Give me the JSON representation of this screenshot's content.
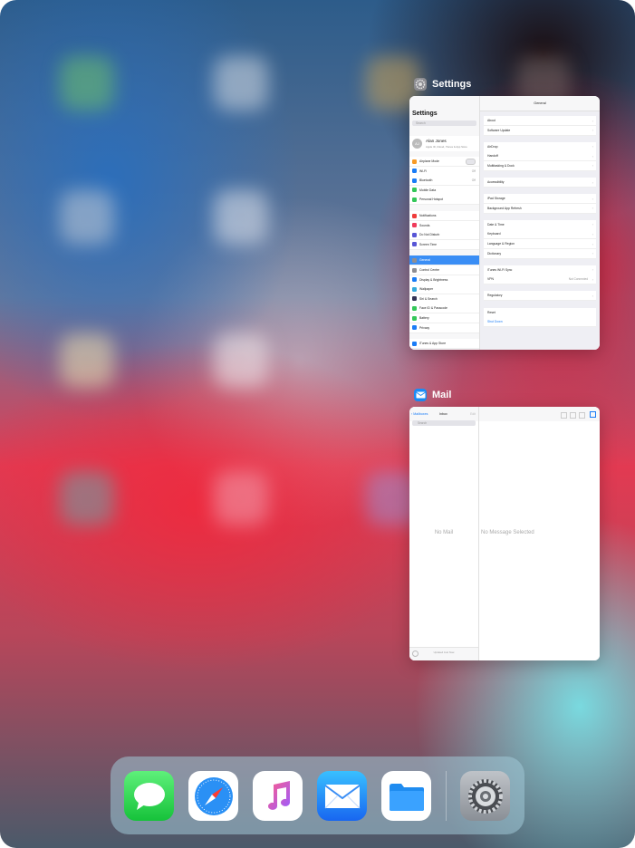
{
  "switcher": {
    "settings_card": {
      "app_name": "Settings",
      "sidebar": {
        "title": "Settings",
        "search_placeholder": "Search",
        "profile": {
          "name": "Alan Jones",
          "subtitle": "Apple ID, iCloud, iTunes & App Store",
          "initials": "AJ"
        },
        "groups": [
          [
            {
              "label": "Airplane Mode",
              "color": "#f79a26",
              "value": ""
            },
            {
              "label": "Wi-Fi",
              "color": "#1a7cf6",
              "value": "Off"
            },
            {
              "label": "Bluetooth",
              "color": "#1a7cf6",
              "value": "Off"
            },
            {
              "label": "Mobile Data",
              "color": "#34c759",
              "value": ""
            },
            {
              "label": "Personal Hotspot",
              "color": "#34c759",
              "value": ""
            }
          ],
          [
            {
              "label": "Notifications",
              "color": "#ef3b3b",
              "value": ""
            },
            {
              "label": "Sounds",
              "color": "#ef3b5b",
              "value": ""
            },
            {
              "label": "Do Not Disturb",
              "color": "#5856d6",
              "value": ""
            },
            {
              "label": "Screen Time",
              "color": "#5856d6",
              "value": ""
            }
          ],
          [
            {
              "label": "General",
              "color": "#8e8e93",
              "value": ""
            },
            {
              "label": "Control Centre",
              "color": "#8e8e93",
              "value": ""
            },
            {
              "label": "Display & Brightness",
              "color": "#1a7cf6",
              "value": ""
            },
            {
              "label": "Wallpaper",
              "color": "#35aadc",
              "value": ""
            },
            {
              "label": "Siri & Search",
              "color": "#333355",
              "value": ""
            },
            {
              "label": "Face ID & Passcode",
              "color": "#34c759",
              "value": ""
            },
            {
              "label": "Battery",
              "color": "#34c759",
              "value": ""
            },
            {
              "label": "Privacy",
              "color": "#1a7cf6",
              "value": ""
            }
          ],
          [
            {
              "label": "iTunes & App Store",
              "color": "#1a7cf6",
              "value": ""
            }
          ]
        ]
      },
      "main": {
        "nav_title": "General",
        "groups": [
          [
            {
              "label": "About",
              "value": ""
            },
            {
              "label": "Software Update",
              "value": ""
            }
          ],
          [
            {
              "label": "AirDrop",
              "value": ""
            },
            {
              "label": "Handoff",
              "value": ""
            },
            {
              "label": "Multitasking & Dock",
              "value": ""
            }
          ],
          [
            {
              "label": "Accessibility",
              "value": ""
            }
          ],
          [
            {
              "label": "iPad Storage",
              "value": ""
            },
            {
              "label": "Background App Refresh",
              "value": ""
            }
          ],
          [
            {
              "label": "Date & Time",
              "value": ""
            },
            {
              "label": "Keyboard",
              "value": ""
            },
            {
              "label": "Language & Region",
              "value": ""
            },
            {
              "label": "Dictionary",
              "value": ""
            }
          ],
          [
            {
              "label": "iTunes Wi-Fi Sync",
              "value": ""
            },
            {
              "label": "VPN",
              "value": "Not Connected"
            }
          ],
          [
            {
              "label": "Regulatory",
              "value": ""
            }
          ],
          [
            {
              "label": "Reset",
              "value": ""
            },
            {
              "label": "Shut Down",
              "value": ""
            }
          ]
        ]
      }
    },
    "mail_card": {
      "app_name": "Mail",
      "back_label": "Mailboxes",
      "list_title": "Inbox",
      "edit_label": "Edit",
      "search_placeholder": "Search",
      "empty_list": "No Mail",
      "empty_detail": "No Message Selected",
      "footer": "Updated Just Now"
    }
  },
  "dock": {
    "apps": [
      {
        "name": "Messages",
        "icon": "messages-icon"
      },
      {
        "name": "Safari",
        "icon": "safari-icon"
      },
      {
        "name": "Music",
        "icon": "music-icon"
      },
      {
        "name": "Mail",
        "icon": "mail-icon"
      },
      {
        "name": "Files",
        "icon": "files-icon"
      },
      {
        "name": "Settings",
        "icon": "settings-icon"
      }
    ]
  }
}
